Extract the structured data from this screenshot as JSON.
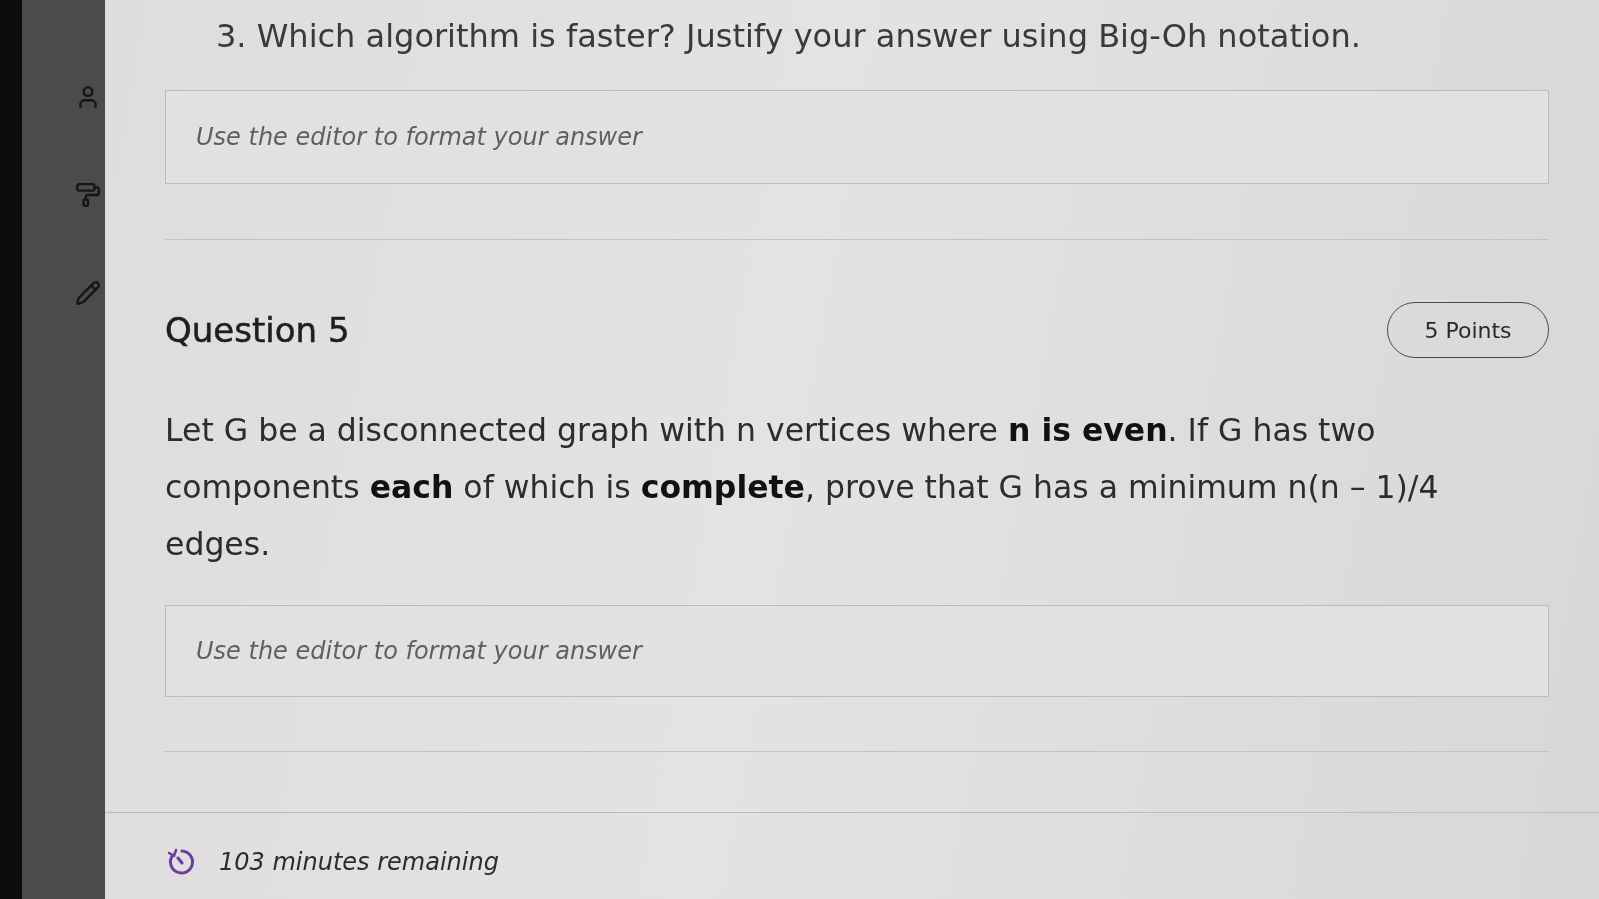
{
  "previous_question": {
    "prompt": "3. Which algorithm is faster? Justify your answer using Big-Oh notation.",
    "answer": {
      "placeholder": "Use the editor to format your answer"
    }
  },
  "question": {
    "title": "Question 5",
    "points": "5 Points",
    "text": "Let G be a disconnected graph with n vertices where **n is even**. If G has two components **each** of which is **complete**, prove that G has a minimum n(n – 1)/4 edges.",
    "answer": {
      "placeholder": "Use the editor to format your answer"
    }
  },
  "timer": {
    "text": "103 minutes remaining"
  }
}
